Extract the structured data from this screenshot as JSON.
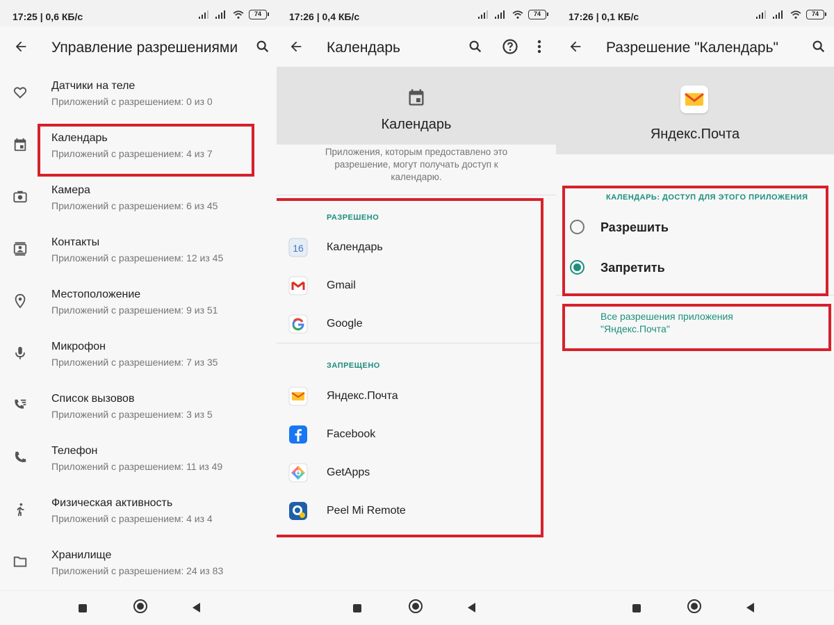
{
  "panel1": {
    "status": {
      "time": "17:25",
      "speed": "0,6 КБ/с",
      "battery": "74"
    },
    "title": "Управление разрешениями",
    "items": [
      {
        "icon": "heart-icon",
        "label": "Датчики на теле",
        "sub": "Приложений с разрешением: 0 из 0"
      },
      {
        "icon": "calendar-icon",
        "label": "Календарь",
        "sub": "Приложений с разрешением: 4 из 7"
      },
      {
        "icon": "camera-icon",
        "label": "Камера",
        "sub": "Приложений с разрешением: 6 из 45"
      },
      {
        "icon": "contacts-icon",
        "label": "Контакты",
        "sub": "Приложений с разрешением: 12 из 45"
      },
      {
        "icon": "location-icon",
        "label": "Местоположение",
        "sub": "Приложений с разрешением: 9 из 51"
      },
      {
        "icon": "microphone-icon",
        "label": "Микрофон",
        "sub": "Приложений с разрешением: 7 из 35"
      },
      {
        "icon": "call-log-icon",
        "label": "Список вызовов",
        "sub": "Приложений с разрешением: 3 из 5"
      },
      {
        "icon": "phone-icon",
        "label": "Телефон",
        "sub": "Приложений с разрешением: 11 из 49"
      },
      {
        "icon": "activity-icon",
        "label": "Физическая активность",
        "sub": "Приложений с разрешением: 4 из 4"
      },
      {
        "icon": "folder-icon",
        "label": "Хранилище",
        "sub": "Приложений с разрешением: 24 из 83"
      }
    ]
  },
  "panel2": {
    "status": {
      "time": "17:26",
      "speed": "0,4 КБ/с",
      "battery": "74"
    },
    "title": "Календарь",
    "header_name": "Календарь",
    "description": "Приложения, которым предоставлено это разрешение, могут получать доступ к календарю.",
    "allowed_label": "РАЗРЕШЕНО",
    "allowed": [
      {
        "icon": "calendar-app-icon",
        "badge": "16",
        "name": "Календарь"
      },
      {
        "icon": "gmail-icon",
        "name": "Gmail"
      },
      {
        "icon": "google-icon",
        "name": "Google"
      }
    ],
    "denied_label": "ЗАПРЕЩЕНО",
    "denied": [
      {
        "icon": "yandex-mail-icon",
        "name": "Яндекс.Почта"
      },
      {
        "icon": "facebook-icon",
        "name": "Facebook"
      },
      {
        "icon": "getapps-icon",
        "name": "GetApps"
      },
      {
        "icon": "peel-remote-icon",
        "name": "Peel Mi Remote"
      }
    ]
  },
  "panel3": {
    "status": {
      "time": "17:26",
      "speed": "0,1 КБ/с",
      "battery": "74"
    },
    "title": "Разрешение \"Календарь\"",
    "app_name": "Яндекс.Почта",
    "section_label": "КАЛЕНДАРЬ: ДОСТУП ДЛЯ ЭТОГО ПРИЛОЖЕНИЯ",
    "options": [
      {
        "label": "Разрешить",
        "selected": false
      },
      {
        "label": "Запретить",
        "selected": true
      }
    ],
    "all_perms_link": "Все разрешения приложения \"Яндекс.Почта\""
  },
  "colors": {
    "accent": "#1c8f7e",
    "highlight": "#d7202b",
    "header_grey": "#e3e3e3"
  }
}
